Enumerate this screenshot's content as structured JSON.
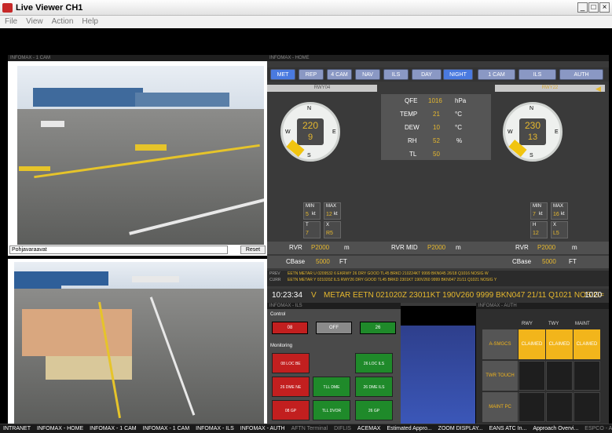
{
  "window": {
    "title": "Live Viewer  CH1",
    "minimize": "_",
    "maximize": "□",
    "close": "×"
  },
  "menu": [
    "File",
    "View",
    "Action",
    "Help"
  ],
  "cam_panel": {
    "header": "INFOMAX - 1 CAM",
    "select_value": "Pohjavaraavat",
    "reset": "Reset"
  },
  "home_panel": {
    "header": "INFOMAX - HOME"
  },
  "tabs": [
    "MET",
    "REP",
    "4 CAM",
    "NAV",
    "ILS",
    "DAY",
    "NIGHT",
    "1 CAM",
    "ILS",
    "AUTH"
  ],
  "rwy_left": "RWY04",
  "rwy_right": "RWY22",
  "wind_left": {
    "dir": "220",
    "speed": "9",
    "min": "5",
    "max": "12",
    "t": "7",
    "x": "R5"
  },
  "wind_right": {
    "dir": "230",
    "speed": "13",
    "min": "7",
    "max": "16",
    "h": "12",
    "x": "L5"
  },
  "compass": {
    "n": "N",
    "s": "S",
    "e": "E",
    "w": "W",
    "kt": "kt",
    "min": "MIN",
    "max": "MAX",
    "t": "T",
    "h": "H",
    "x": "X"
  },
  "met": {
    "qfe_l": "QFE",
    "qfe_v": "1016",
    "qfe_u": "hPa",
    "temp_l": "TEMP",
    "temp_v": "21",
    "temp_u": "°C",
    "dew_l": "DEW",
    "dew_v": "10",
    "dew_u": "°C",
    "rh_l": "RH",
    "rh_v": "52",
    "rh_u": "%",
    "tl_l": "TL",
    "tl_v": "50"
  },
  "rvr": {
    "l_label": "RVR",
    "l_val": "P2000",
    "l_unit": "m",
    "mid_label": "RVR MID",
    "mid_val": "P2000",
    "mid_unit": "m",
    "r_label": "RVR",
    "r_val": "P2000",
    "r_unit": "m"
  },
  "cbase": {
    "l_label": "CBase",
    "l_val": "5000",
    "l_unit": "FT",
    "r_label": "CBase",
    "r_val": "5000",
    "r_unit": "FT"
  },
  "metar_lines": [
    {
      "tag": "PREV",
      "text": "EETN METAR U 0209532 6 EKRWY 26 DRY GOOD TL45 BRKD 210224KT 9999 BKN045 26/18 Q1016 NOSIG W"
    },
    {
      "tag": "CURR",
      "text": "EETN METAR Y 021020Z ILS RWY26 DRY GOOD TL45 BRKD 2301KT 190V260 9999 BKN047 21/11 Q1021 NOSIG Y"
    }
  ],
  "metar_bar": {
    "time": "10:23:34",
    "flag": "V",
    "text": "METAR EETN 021020Z 23011KT 190V260 9999 BKN047 21/11 Q1021 NOSIG=",
    "value": "1020"
  },
  "ils_panel": {
    "header": "INFOMAX - ILS",
    "control": "Control",
    "monitoring": "Monitoring",
    "ctrl": [
      "08",
      "OFF",
      "26"
    ],
    "mon": [
      "08 LOC BE",
      "26 LOC ILS",
      "26 DME NE",
      "TLL DME",
      "26 DME ILS",
      "08 GP",
      "TLL DVOR",
      "26 GP"
    ]
  },
  "auth_panel": {
    "header": "INFOMAX - AUTH",
    "cols": [
      "RWY",
      "TWY",
      "MAINT"
    ],
    "rows": [
      {
        "name": "A-SMGCS",
        "cells": [
          "CLAIMED",
          "CLAIMED",
          "CLAIMED"
        ]
      },
      {
        "name": "TWR TOUCH",
        "cells": [
          "",
          "",
          ""
        ]
      },
      {
        "name": "MAINT PC",
        "cells": [
          "",
          "",
          ""
        ]
      }
    ]
  },
  "taskbar": [
    "INTRANET",
    "INFOMAX - HOME",
    "INFOMAX - 1 CAM",
    "INFOMAX - 1 CAM",
    "INFOMAX - ILS",
    "INFOMAX - AUTH",
    "AFTN Terminal",
    "DIFLIS",
    "ACEMAX",
    "Estimated Appro...",
    "ZOOM DISPLAY...",
    "EANS ATC In...",
    "Approach Overvi...",
    "ESPCO - AFT..."
  ],
  "colors": {
    "claimed": "#f2b51b",
    "accent": "#e6b82e",
    "red": "#c21f1f",
    "green": "#1f8a2a"
  }
}
